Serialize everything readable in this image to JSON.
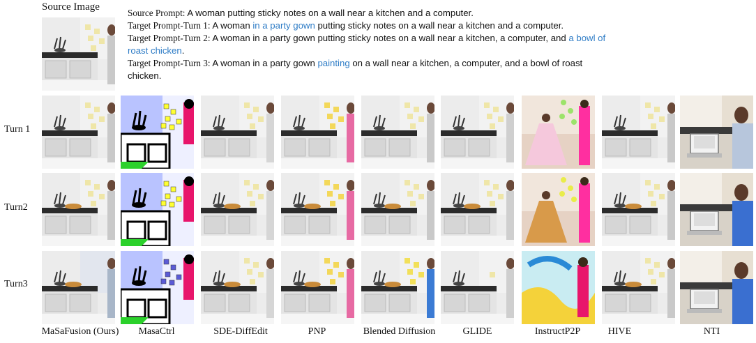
{
  "header": {
    "source_label": "Source Image",
    "source_prompt": {
      "key": "Source Prompt:",
      "text": " A woman putting sticky notes on a wall near a kitchen and a computer."
    },
    "turn1": {
      "key": "Target Prompt-Turn 1:",
      "a": " A woman ",
      "hl": "in a party gown",
      "b": " putting sticky notes on a wall near a kitchen and a computer."
    },
    "turn2": {
      "key": "Target Prompt-Turn 2:",
      "a": " A woman in a party gown putting sticky notes on a wall near a kitchen, a computer, and ",
      "hl": "a bowl of roast chicken",
      "b": "."
    },
    "turn3": {
      "key": "Target Prompt-Turn 3:",
      "a": " A woman in a party gown ",
      "hl": "painting",
      "b": " on a wall near a kitchen, a computer, and a bowl of roast chicken."
    },
    "highlight_color": "#2e7cc6"
  },
  "rows": [
    {
      "label": "Turn 1"
    },
    {
      "label": "Turn2"
    },
    {
      "label": "Turn3"
    }
  ],
  "columns": [
    {
      "label": "MaSaFusion (Ours)"
    },
    {
      "label": "MasaCtrl"
    },
    {
      "label": "SDE-DiffEdit"
    },
    {
      "label": "PNP"
    },
    {
      "label": "Blended Diffusion"
    },
    {
      "label": "GLIDE"
    },
    {
      "label": "InstructP2P"
    },
    {
      "label": "HIVE"
    },
    {
      "label": "NTI"
    }
  ]
}
